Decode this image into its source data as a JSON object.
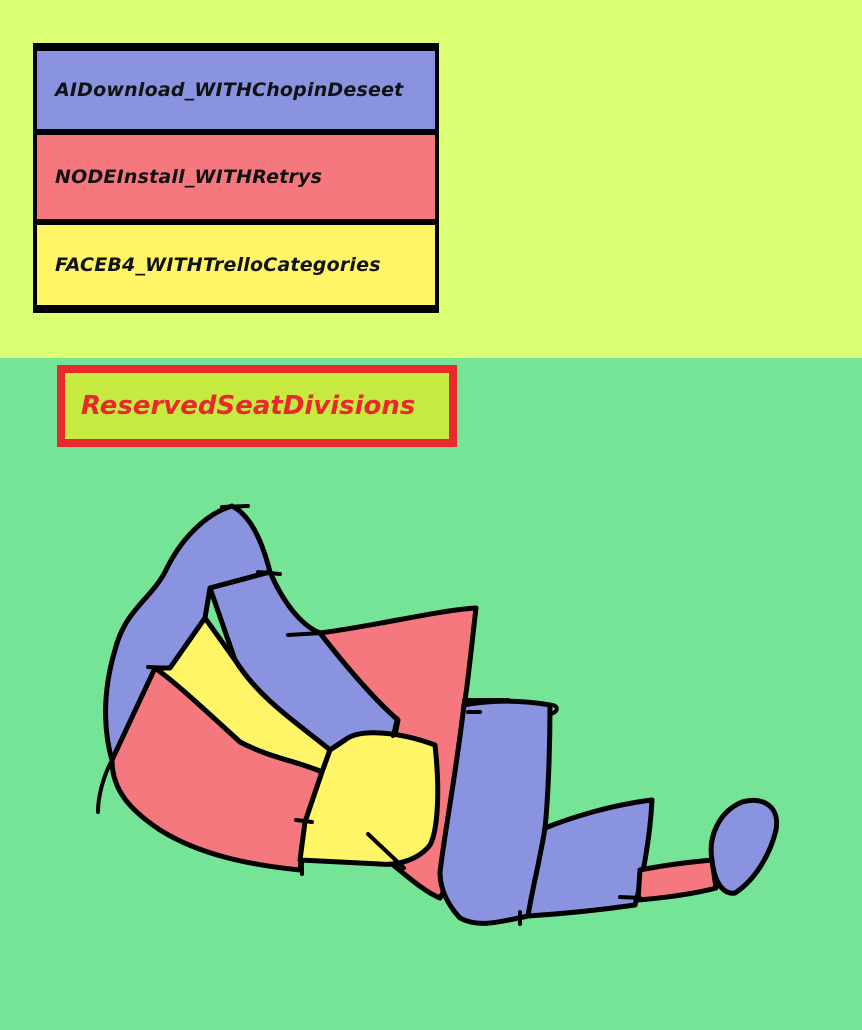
{
  "legend": {
    "items": [
      {
        "label": "AIDownload_WITHChopinDeseet",
        "color": "#8993df"
      },
      {
        "label": "NODEInstall_WITHRetrys",
        "color": "#f4787d"
      },
      {
        "label": "FACEB4_WITHTrelloCategories",
        "color": "#fff566"
      }
    ]
  },
  "title": "ReservedSeatDivisions",
  "colors": {
    "top_background": "#dcfe72",
    "bottom_background": "#76e497",
    "title_border": "#e82a2e",
    "title_fill": "#c6ea40",
    "blue": "#8993df",
    "red": "#f4787d",
    "yellow": "#fff566",
    "outline": "#000000"
  }
}
